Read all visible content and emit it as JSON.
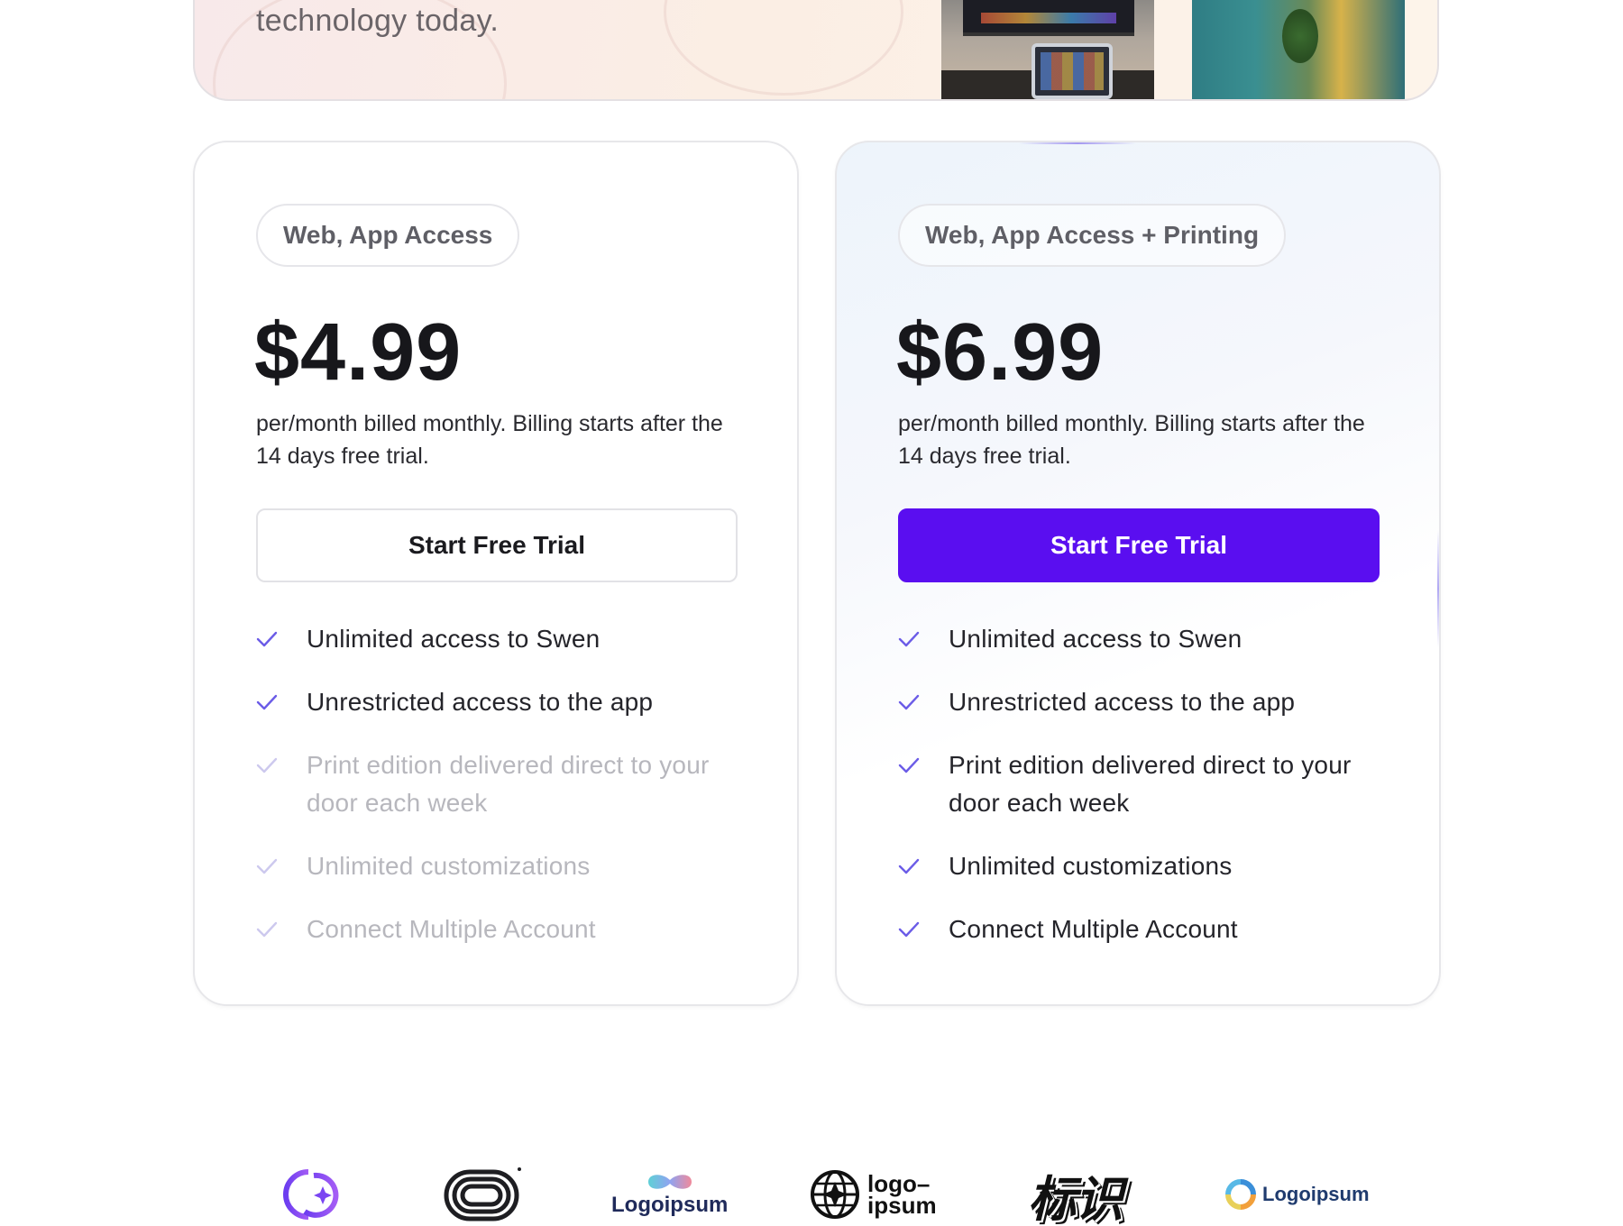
{
  "hero": {
    "text": "technology today."
  },
  "plans": [
    {
      "badge": "Web, App Access",
      "price": "$4.99",
      "note": "per/month billed monthly. Billing starts after the 14 days free trial.",
      "cta": "Start Free Trial",
      "features": [
        "Unlimited access to Swen",
        "Unrestricted access to the app",
        "Print edition delivered direct to your door each week",
        "Unlimited customizations",
        "Connect Multiple Account"
      ]
    },
    {
      "badge": "Web, App Access + Printing",
      "price": "$6.99",
      "note": "per/month billed monthly. Billing starts after the 14 days free trial.",
      "cta": "Start Free Trial",
      "features": [
        "Unlimited access to Swen",
        "Unrestricted access to the app",
        "Print edition delivered direct to your door each week",
        "Unlimited customizations",
        "Connect Multiple Account"
      ]
    }
  ],
  "logos": {
    "logo3": "Logoipsum",
    "logo4_line1": "logo–",
    "logo4_line2": "ipsum",
    "logo5": "标识",
    "logo6": "Logoipsum"
  },
  "colors": {
    "accent": "#5a0ef0",
    "check": "#6b5ce7",
    "muted_text": "#b7b7bd"
  }
}
